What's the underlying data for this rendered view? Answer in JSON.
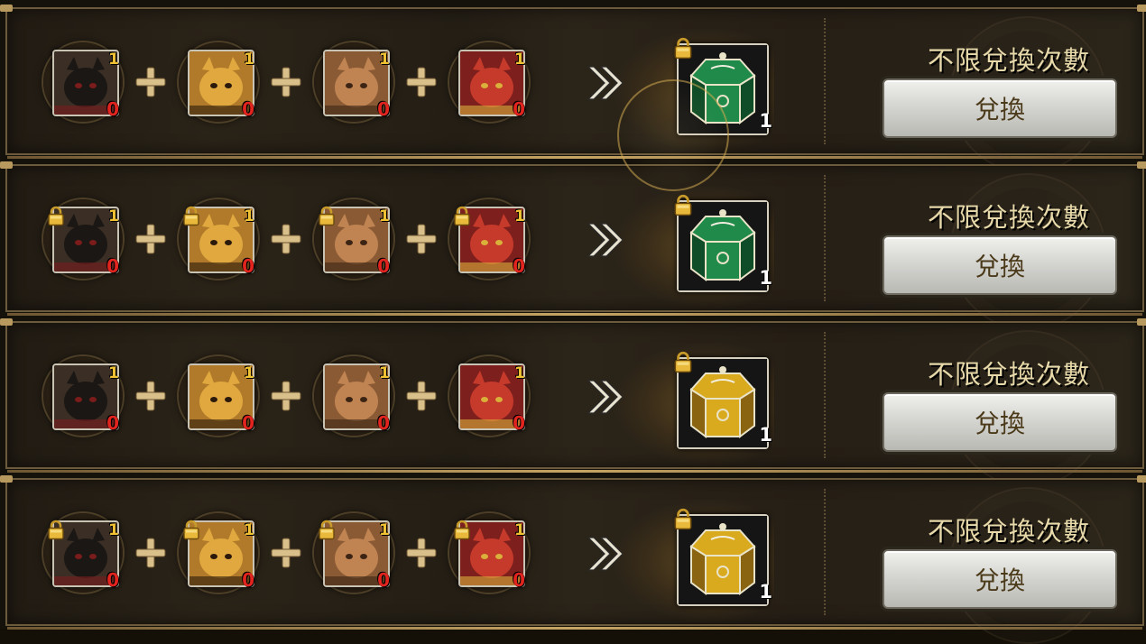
{
  "rows": [
    {
      "materials_locked": false,
      "reward_locked": true,
      "materials": [
        {
          "name": "black-cat-card",
          "need": "1",
          "have": "0"
        },
        {
          "name": "tiger-card",
          "need": "1",
          "have": "0"
        },
        {
          "name": "brown-cat-card",
          "need": "1",
          "have": "0"
        },
        {
          "name": "lion-dance-card",
          "need": "1",
          "have": "0"
        }
      ],
      "reward": {
        "name": "green-treasure-box",
        "quantity": "1"
      },
      "limit_text": "不限兌換次數",
      "button_label": "兌換"
    },
    {
      "materials_locked": true,
      "reward_locked": true,
      "materials": [
        {
          "name": "black-cat-card",
          "need": "1",
          "have": "0"
        },
        {
          "name": "tiger-card",
          "need": "1",
          "have": "0"
        },
        {
          "name": "brown-cat-card",
          "need": "1",
          "have": "0"
        },
        {
          "name": "lion-dance-card",
          "need": "1",
          "have": "0"
        }
      ],
      "reward": {
        "name": "green-treasure-box",
        "quantity": "1"
      },
      "limit_text": "不限兌換次數",
      "button_label": "兌換"
    },
    {
      "materials_locked": false,
      "reward_locked": true,
      "materials": [
        {
          "name": "black-cat-card",
          "need": "1",
          "have": "0"
        },
        {
          "name": "tiger-card",
          "need": "1",
          "have": "0"
        },
        {
          "name": "brown-cat-card",
          "need": "1",
          "have": "0"
        },
        {
          "name": "lion-dance-card",
          "need": "1",
          "have": "0"
        }
      ],
      "reward": {
        "name": "gold-treasure-box",
        "quantity": "1"
      },
      "limit_text": "不限兌換次數",
      "button_label": "兌換"
    },
    {
      "materials_locked": true,
      "reward_locked": true,
      "materials": [
        {
          "name": "black-cat-card",
          "need": "1",
          "have": "0"
        },
        {
          "name": "tiger-card",
          "need": "1",
          "have": "0"
        },
        {
          "name": "brown-cat-card",
          "need": "1",
          "have": "0"
        },
        {
          "name": "lion-dance-card",
          "need": "1",
          "have": "0"
        }
      ],
      "reward": {
        "name": "gold-treasure-box",
        "quantity": "1"
      },
      "limit_text": "不限兌換次數",
      "button_label": "兌換"
    }
  ],
  "colors": {
    "need_count": "#f0c233",
    "have_count": "#e2241f",
    "label_text": "#e7d9a9",
    "green_box": "#1f8a4a",
    "gold_box": "#d9a91e"
  }
}
